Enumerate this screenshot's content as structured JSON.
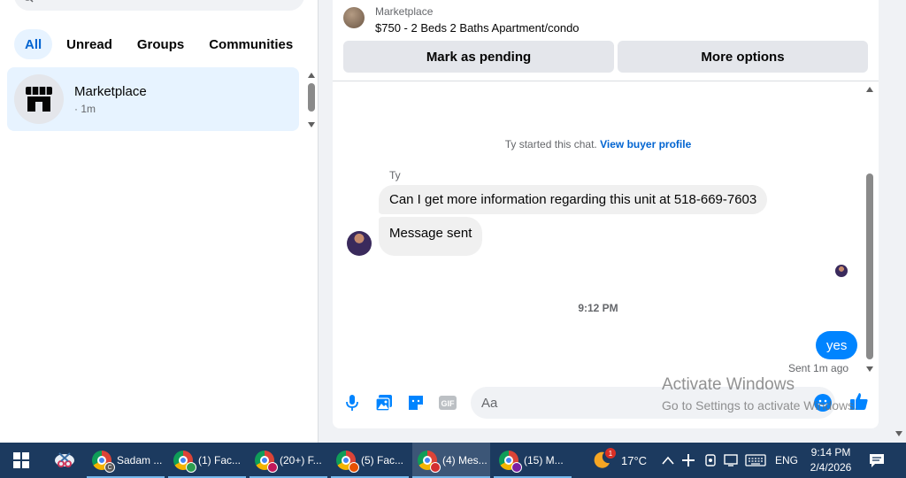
{
  "left_panel": {
    "filters": [
      {
        "label": "All",
        "active": true
      },
      {
        "label": "Unread",
        "active": false
      },
      {
        "label": "Groups",
        "active": false
      },
      {
        "label": "Communities",
        "active": false
      }
    ],
    "conversation": {
      "name": "Marketplace",
      "time": "· 1m"
    }
  },
  "chat": {
    "header": {
      "title": "Marketplace",
      "listing": "$750 - 2 Beds 2 Baths Apartment/condo",
      "pending_button": "Mark as pending",
      "more_button": "More options"
    },
    "started_text": "Ty started this chat.",
    "buyer_profile_link": "View buyer profile",
    "sender_name": "Ty",
    "messages_in": [
      "Can I get more information regarding this unit at 518-669-7603",
      "Message sent"
    ],
    "timestamp": "9:12 PM",
    "message_out": "yes",
    "sent_status": "Sent 1m ago",
    "composer": {
      "placeholder": "Aa"
    },
    "accent_color": "#0084ff"
  },
  "watermark": {
    "line1": "Activate Windows",
    "line2": "Go to Settings to activate Windows."
  },
  "taskbar": {
    "tasks": [
      {
        "label": "Sadam ...",
        "badge": "C"
      },
      {
        "label": "(1) Fac..."
      },
      {
        "label": "(20+) F..."
      },
      {
        "label": "(5) Fac..."
      },
      {
        "label": "(4) Mes...",
        "active": true
      },
      {
        "label": "(15) M..."
      }
    ],
    "weather": {
      "temp": "17°C",
      "badge": "1"
    },
    "language": "ENG",
    "time": "9:14 PM",
    "date": "2/4/2026"
  }
}
